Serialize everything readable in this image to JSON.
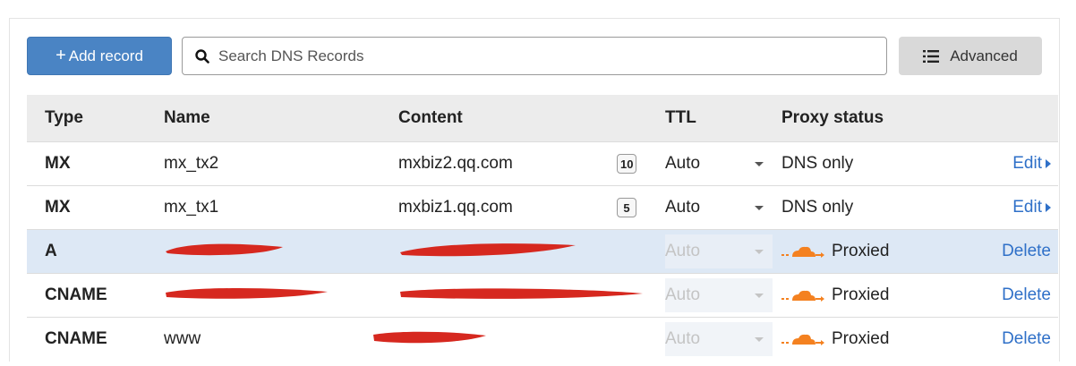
{
  "toolbar": {
    "add_label": "Add record",
    "search_placeholder": "Search DNS Records",
    "advanced_label": "Advanced"
  },
  "table": {
    "headers": {
      "type": "Type",
      "name": "Name",
      "content": "Content",
      "ttl": "TTL",
      "proxy": "Proxy status"
    },
    "rows": [
      {
        "type": "MX",
        "name": "mx_tx2",
        "content": "mxbiz2.qq.com",
        "priority": "10",
        "ttl": "Auto",
        "proxy": "DNS only",
        "action": "Edit"
      },
      {
        "type": "MX",
        "name": "mx_tx1",
        "content": "mxbiz1.qq.com",
        "priority": "5",
        "ttl": "Auto",
        "proxy": "DNS only",
        "action": "Edit"
      },
      {
        "type": "A",
        "name": "",
        "content": "",
        "ttl": "Auto",
        "proxy": "Proxied",
        "action": "Delete"
      },
      {
        "type": "CNAME",
        "name": "",
        "content": "",
        "ttl": "Auto",
        "proxy": "Proxied",
        "action": "Delete"
      },
      {
        "type": "CNAME",
        "name": "www",
        "content": "",
        "ttl": "Auto",
        "proxy": "Proxied",
        "action": "Delete"
      }
    ]
  },
  "colors": {
    "accent": "#4a84c4",
    "link": "#2f70c8",
    "proxied_cloud": "#f48120",
    "redaction": "#d6281f",
    "highlight_row": "#dde8f5"
  },
  "icons": {
    "search": "search-icon",
    "advanced": "filter-list-icon",
    "cloud": "cloud-proxied-icon",
    "edit_arrow": "caret-right-icon",
    "ttl_dropdown": "chevron-down-icon"
  }
}
